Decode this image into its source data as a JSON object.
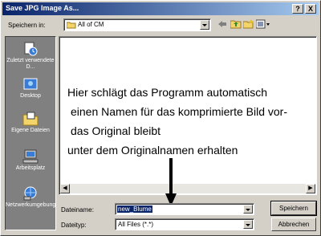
{
  "window": {
    "title": "Save JPG Image As..."
  },
  "titlebar_buttons": {
    "help": "?",
    "close": "X"
  },
  "save_in": {
    "label": "Speichern in:",
    "value": "All of CM"
  },
  "places": [
    {
      "label": "Zuletzt verwendete D...",
      "icon": "recent-documents-icon"
    },
    {
      "label": "Desktop",
      "icon": "desktop-icon"
    },
    {
      "label": "Eigene Dateien",
      "icon": "my-documents-icon"
    },
    {
      "label": "Arbeitsplatz",
      "icon": "my-computer-icon"
    },
    {
      "label": "Netzwerkumgebung",
      "icon": "network-icon"
    }
  ],
  "annotation": {
    "line1": "Hier schlägt das Programm automatisch",
    "line2": "einen Namen für das komprimierte Bild vor-",
    "line3": "das Original bleibt",
    "line4": "unter dem Originalnamen erhalten"
  },
  "filename": {
    "label": "Dateiname:",
    "value": "new_Blume"
  },
  "filetype": {
    "label": "Dateityp:",
    "value": "All Files (*.*)"
  },
  "buttons": {
    "save": "Speichern",
    "cancel": "Abbrechen"
  }
}
